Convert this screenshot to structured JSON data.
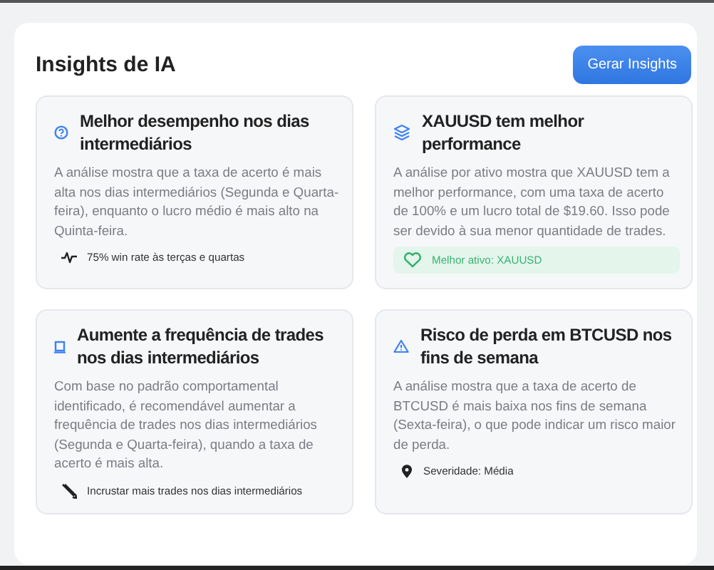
{
  "panel": {
    "title": "Insights de IA",
    "button": "Gerar Insights"
  },
  "cards": [
    {
      "title": "Melhor desempenho nos dias intermediários",
      "text": "A análise mostra que a taxa de acerto é mais alta nos dias intermediários (Segunda e Quarta-feira), enquanto o lucro médio é mais alto na Quinta-feira.",
      "footer": {
        "kind": "plain",
        "text": "75% win rate às terças e quartas"
      }
    },
    {
      "title": "XAUUSD tem melhor performance",
      "text": "A análise por ativo mostra que XAUUSD tem a melhor performance, com uma taxa de acerto de 100% e um lucro total de $19.60. Isso pode ser devido à sua menor quantidade de trades.",
      "footer": {
        "kind": "highlight",
        "text": "Melhor ativo: XAUUSD"
      }
    },
    {
      "title": "Aumente a frequência de trades nos dias intermediários",
      "text": "Com base no padrão comportamental identificado, é recomendável aumentar a frequência de trades nos dias intermediários (Segunda e Quarta-feira), quando a taxa de acerto é mais alta.",
      "footer": {
        "kind": "plain",
        "text": "Incrustar mais trades nos dias intermediários"
      }
    },
    {
      "title": "Risco de perda em BTCUSD nos fins de semana",
      "text": "A análise mostra que a taxa de acerto de BTCUSD é mais baixa nos fins de semana (Sexta-feira), o que pode indicar um risco maior de perda.",
      "footer": {
        "kind": "plain",
        "text": "Severidade: Média"
      }
    }
  ]
}
